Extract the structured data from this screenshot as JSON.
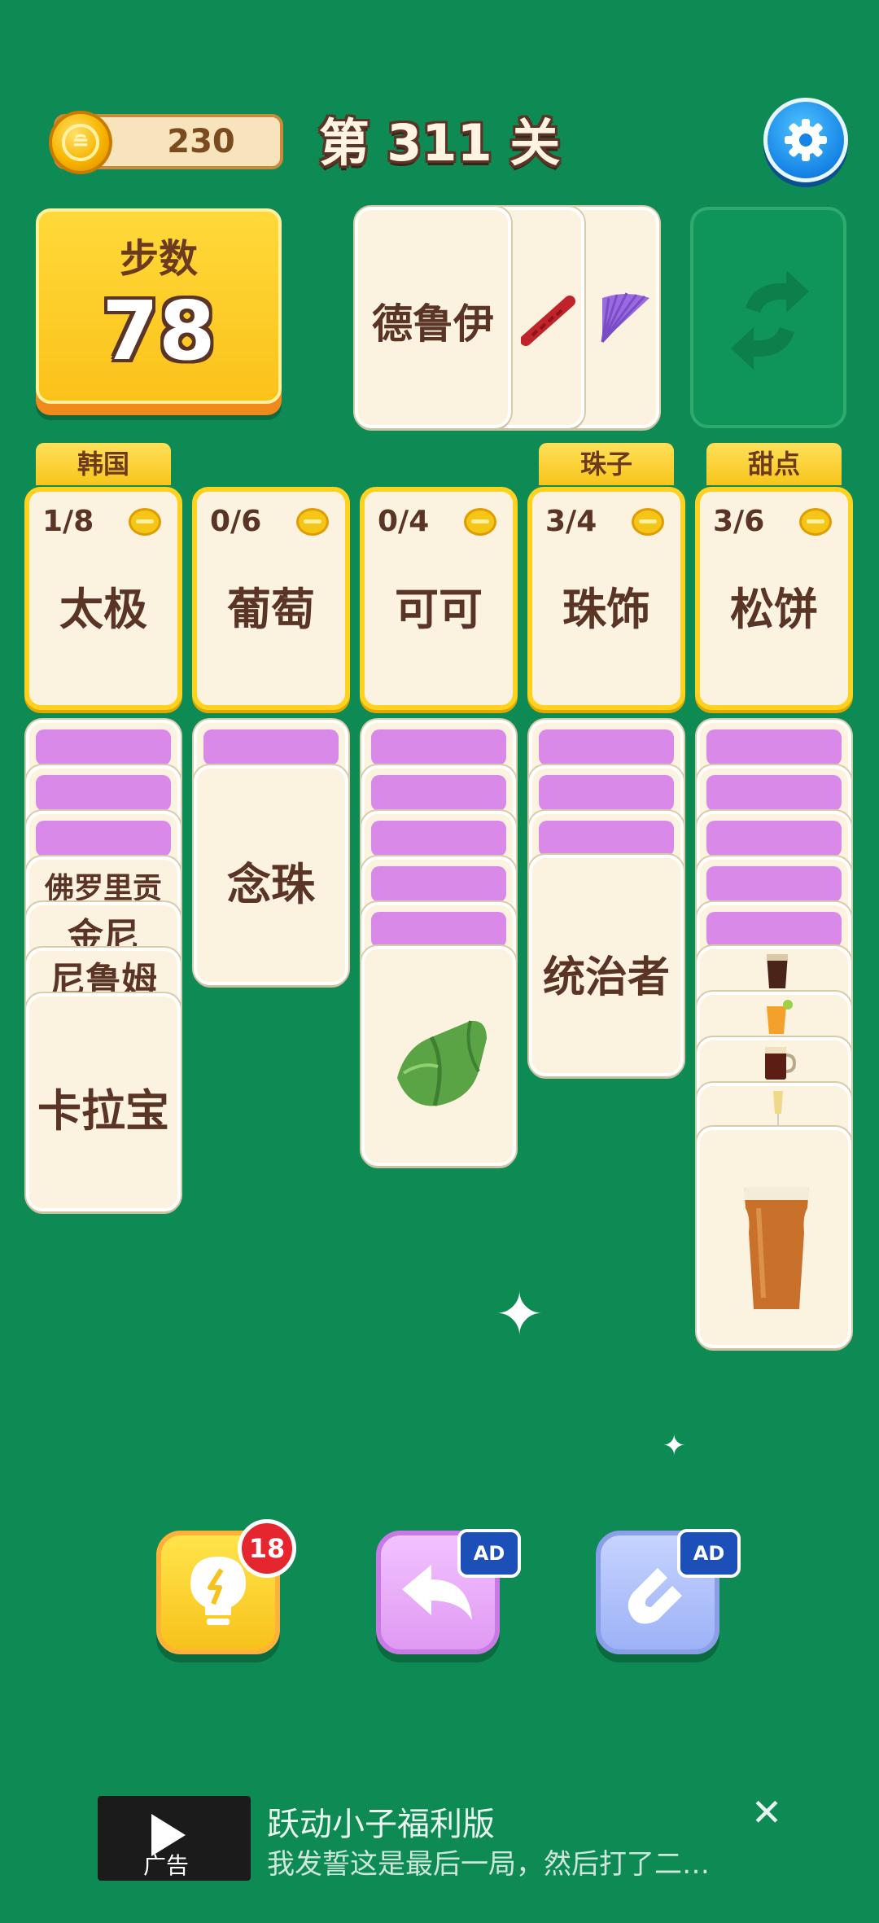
{
  "header": {
    "coins": "230",
    "coin_icon_glyph": "≘",
    "level_title": "第 311 关",
    "settings_icon": "gear-icon"
  },
  "moves": {
    "label": "步数",
    "value": "78"
  },
  "draw_pile": {
    "top_card": "德鲁伊",
    "under_card_1_icon": "red-ribbon-icon",
    "under_card_2_icon": "purple-fan-icon"
  },
  "recycle": {
    "icon": "recycle-arrows-icon"
  },
  "slots": [
    {
      "tag": "韩国",
      "count": "1/8",
      "label": "太极"
    },
    {
      "tag": "",
      "count": "0/6",
      "label": "葡萄"
    },
    {
      "tag": "",
      "count": "0/4",
      "label": "可可"
    },
    {
      "tag": "珠子",
      "count": "3/4",
      "label": "珠饰"
    },
    {
      "tag": "甜点",
      "count": "3/6",
      "label": "松饼"
    }
  ],
  "columns": {
    "col1": {
      "stacked": [
        "佛罗里贡",
        "金尼",
        "尼鲁姆"
      ],
      "top": "卡拉宝"
    },
    "col2": {
      "top": "念珠"
    },
    "col3": {
      "top_icon": "green-cloth-icon"
    },
    "col4": {
      "top": "统治者"
    },
    "col5": {
      "stacked_icons": [
        "dark-beer-glass-icon",
        "orange-cocktail-icon",
        "dark-beer-mug-icon",
        "champagne-glass-icon"
      ],
      "top_icon": "pint-beer-icon"
    }
  },
  "tools": {
    "hint": {
      "icon": "lightbulb-icon",
      "badge": "18"
    },
    "undo": {
      "icon": "undo-arrow-icon",
      "ad_label": "AD"
    },
    "magnet": {
      "icon": "magnet-icon",
      "ad_label": "AD"
    }
  },
  "ad": {
    "thumb_label": "广告",
    "title": "跃动小子福利版",
    "description": "我发誓这是最后一局，然后打了二…",
    "close_glyph": "✕"
  },
  "colors": {
    "background": "#0e8a55",
    "card": "#fbf3df",
    "slot_border": "#ffd21f",
    "card_back": "#d98ae8"
  }
}
